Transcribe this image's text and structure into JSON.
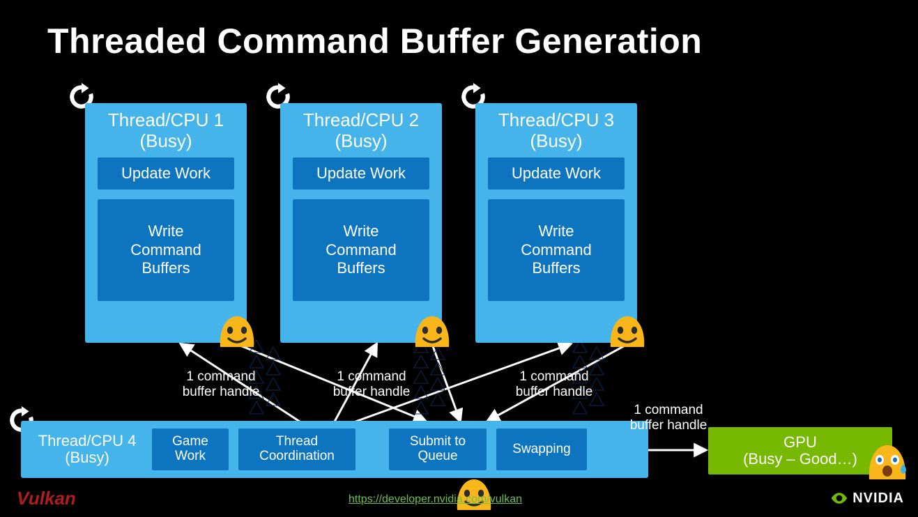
{
  "title": "Threaded Command Buffer Generation",
  "threads": [
    {
      "title1": "Thread/CPU 1",
      "title2": "(Busy)",
      "update": "Update Work",
      "write": "Write\nCommand\nBuffers"
    },
    {
      "title1": "Thread/CPU 2",
      "title2": "(Busy)",
      "update": "Update Work",
      "write": "Write\nCommand\nBuffers"
    },
    {
      "title1": "Thread/CPU 3",
      "title2": "(Busy)",
      "update": "Update Work",
      "write": "Write\nCommand\nBuffers"
    }
  ],
  "thread4": {
    "title1": "Thread/CPU 4",
    "title2": "(Busy)",
    "boxes": [
      "Game\nWork",
      "Thread\nCoordination",
      "Submit to\nQueue",
      "Swapping"
    ]
  },
  "labels": {
    "cb1": "1 command\nbuffer handle",
    "cb2": "1 command\nbuffer handle",
    "cb3": "1 command\nbuffer handle",
    "cb4": "1 command\nbuffer handle"
  },
  "gpu": "GPU\n(Busy – Good…)",
  "footer": {
    "link": "https://developer.nvidia.com/vulkan",
    "vulkan": "Vulkan",
    "nvidia": "NVIDIA"
  },
  "colors": {
    "cardFill": "#44b4ea",
    "innerFill": "#0d75c0",
    "gpuFill": "#76b900",
    "emojiYellow": "#f9b61b",
    "emojiOrange": "#f58a0e"
  }
}
